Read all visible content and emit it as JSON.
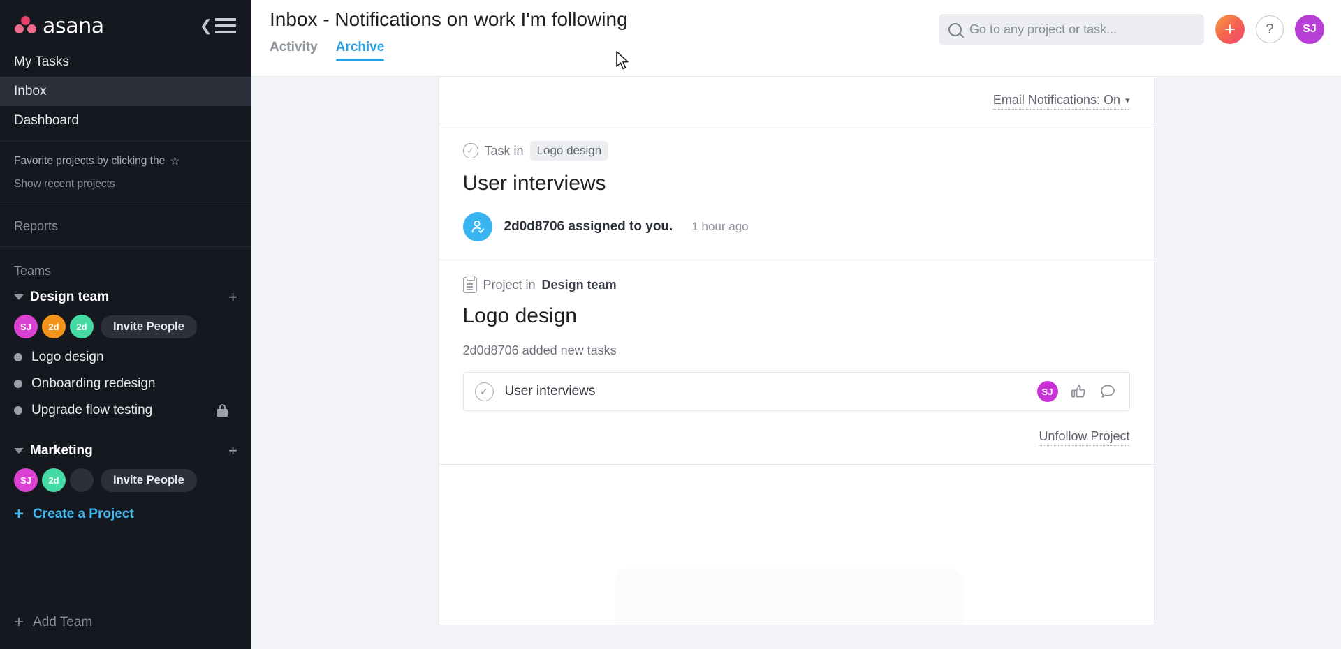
{
  "sidebar": {
    "brand": "asana",
    "collapse_icon": "collapse-sidebar-icon",
    "nav": [
      {
        "label": "My Tasks",
        "active": false
      },
      {
        "label": "Inbox",
        "active": true
      },
      {
        "label": "Dashboard",
        "active": false
      }
    ],
    "favorites_hint": "Favorite projects by clicking the",
    "show_recent": "Show recent projects",
    "reports_label": "Reports",
    "teams_label": "Teams",
    "teams": [
      {
        "name": "Design team",
        "invite_label": "Invite People",
        "members": [
          {
            "initials": "SJ",
            "color": "#d942d0"
          },
          {
            "initials": "2d",
            "color": "#f2931c"
          },
          {
            "initials": "2d",
            "color": "#45d9a4"
          }
        ],
        "projects": [
          {
            "name": "Logo design",
            "locked": false
          },
          {
            "name": "Onboarding redesign",
            "locked": false
          },
          {
            "name": "Upgrade flow testing",
            "locked": true
          }
        ]
      },
      {
        "name": "Marketing",
        "invite_label": "Invite People",
        "members": [
          {
            "initials": "SJ",
            "color": "#d942d0"
          },
          {
            "initials": "2d",
            "color": "#45d9a4"
          },
          {
            "initials": "",
            "color": "#2b303b"
          }
        ],
        "projects": []
      }
    ],
    "create_project": "Create a Project",
    "add_team": "Add Team"
  },
  "header": {
    "title": "Inbox - Notifications on work I'm following",
    "tabs": [
      {
        "label": "Activity",
        "active": false
      },
      {
        "label": "Archive",
        "active": true
      }
    ],
    "search": {
      "placeholder": "Go to any project or task...",
      "value": ""
    },
    "add_button_label": "+",
    "help_button_label": "?",
    "user_avatar": {
      "initials": "SJ",
      "color": "#b83fd6"
    },
    "accent_color": "#2a9fe0"
  },
  "inbox": {
    "email_notifications_label": "Email Notifications: On",
    "notifications": [
      {
        "kind_label": "Task in",
        "kind_icon": "circle-check-icon",
        "context_pill": "Logo design",
        "title": "User interviews",
        "event_icon": "assigned-user-icon",
        "event_text": "2d0d8706 assigned to you.",
        "event_time": "1 hour ago"
      },
      {
        "kind_label": "Project in",
        "kind_icon": "clipboard-icon",
        "context_name": "Design team",
        "title": "Logo design",
        "sub_text": "2d0d8706 added new tasks",
        "task": {
          "name": "User interviews",
          "avatar": {
            "initials": "SJ",
            "color": "#c832d6"
          },
          "like_icon": "thumbs-up-icon",
          "comment_icon": "comment-bubble-icon"
        },
        "unfollow_label": "Unfollow Project"
      }
    ]
  }
}
